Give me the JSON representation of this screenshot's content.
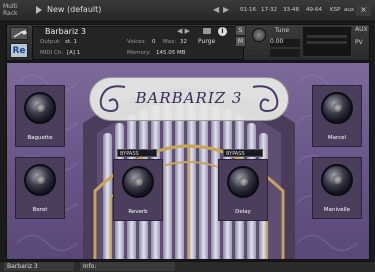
{
  "rack": {
    "title_line1": "Multi",
    "title_line2": "Rack",
    "name": "New (default)",
    "prev": "◀",
    "next": "▶",
    "tabs": [
      "01-16",
      "17-32",
      "33-48",
      "49-64",
      "KSP"
    ],
    "aux": "aux",
    "close": "×"
  },
  "instrument": {
    "name": "Barbariz 3",
    "arrows": "◀ ▶",
    "info": "i",
    "output_label": "Output:",
    "output_value": "st. 1",
    "voices_label": "Voices:",
    "voices_value": "0",
    "max_label": "Max:",
    "max_value": "32",
    "purge_label": "Purge",
    "midi_label": "MIDI Ch:",
    "midi_value": "[A] 1",
    "memory_label": "Memory:",
    "memory_value": "145.05 MB",
    "s_button": "S",
    "m_button": "M",
    "tune_label": "Tune",
    "tune_value": "0.00",
    "aux_label": "AUX",
    "pv_label": "PV",
    "logo_text": "Re"
  },
  "panel": {
    "title": "BARBARIZ 3",
    "dropdown_left": "BYPASS",
    "dropdown_right": "BYPASS",
    "knobs": {
      "baguette": "Baguette",
      "beret": "Beret",
      "reverb": "Reverb",
      "delay": "Delay",
      "marcel": "Marcel",
      "manivelle": "Manivelle"
    }
  },
  "status": {
    "instrument": "Barbariz 3",
    "info": "Info:"
  }
}
